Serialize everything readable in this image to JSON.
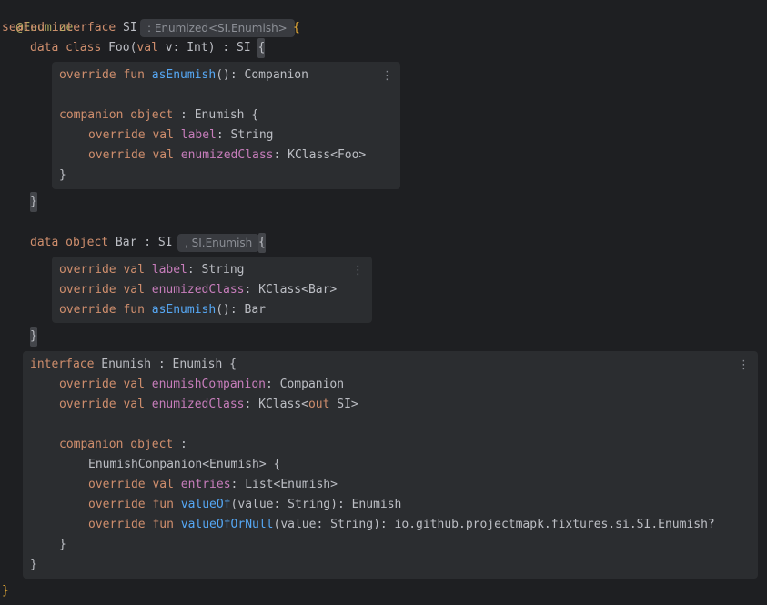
{
  "code": {
    "annotation": "@Enumize",
    "sealed_kw": "sealed interface",
    "sealed_name": " SI",
    "hint_enumized": ": Enumized<SI.Enumish>",
    "open_brace": "{",
    "close_brace": "}",
    "foo": {
      "kw1": "data class",
      "name": " Foo(",
      "val_kw": "val",
      "param": " v",
      "rest": ": Int) : SI ",
      "brace": "{"
    },
    "foo_panel": {
      "l1_kw": "override fun ",
      "l1_fn": "asEnumish",
      "l1_rest": "(): Companion",
      "l2_kw": "companion object",
      "l2_rest": " : Enumish {",
      "l3_kw": "override val ",
      "l3_prop": "label",
      "l3_rest": ": String",
      "l4_kw": "override val ",
      "l4_prop": "enumizedClass",
      "l4_rest": ": KClass<Foo>",
      "l5": "}"
    },
    "foo_close": "}",
    "bar": {
      "kw1": "data object",
      "name": " Bar : SI",
      "hint": ", SI.Enumish",
      "brace": "{"
    },
    "bar_panel": {
      "l1_kw": "override val ",
      "l1_prop": "label",
      "l1_rest": ": String",
      "l2_kw": "override val ",
      "l2_prop": "enumizedClass",
      "l2_rest": ": KClass<Bar>",
      "l3_kw": "override fun ",
      "l3_fn": "asEnumish",
      "l3_rest": "(): Bar"
    },
    "bar_close": "}",
    "enumish_panel": {
      "l1_kw": "interface",
      "l1_rest": " Enumish : Enumish {",
      "l2_kw": "override val ",
      "l2_prop": "enumishCompanion",
      "l2_rest": ": Companion",
      "l3_kw": "override val ",
      "l3_prop": "enumizedClass",
      "l3_mid": ": KClass<",
      "l3_out": "out",
      "l3_rest": " SI>",
      "l4_kw": "companion object",
      "l4_rest": " :",
      "l5": "EnumishCompanion<Enumish> {",
      "l6_kw": "override val ",
      "l6_prop": "entries",
      "l6_rest": ": List<Enumish>",
      "l7_kw": "override fun ",
      "l7_fn": "valueOf",
      "l7_rest": "(value: String): Enumish",
      "l8_kw": "override fun ",
      "l8_fn": "valueOfOrNull",
      "l8_rest": "(value: String): io.github.projectmapk.fixtures.si.SI.Enumish?",
      "l9": "}",
      "l10": "}"
    },
    "final_close": "}"
  },
  "icons": {
    "menu": "⋮"
  },
  "colors": {
    "background": "#1e1f22",
    "panel": "#2b2d30",
    "keyword": "#cf8e6d",
    "annotation": "#b3ae60",
    "function": "#56a8f5",
    "property": "#c77dbb",
    "brace": "#e9ad37",
    "text": "#bcbec4"
  }
}
